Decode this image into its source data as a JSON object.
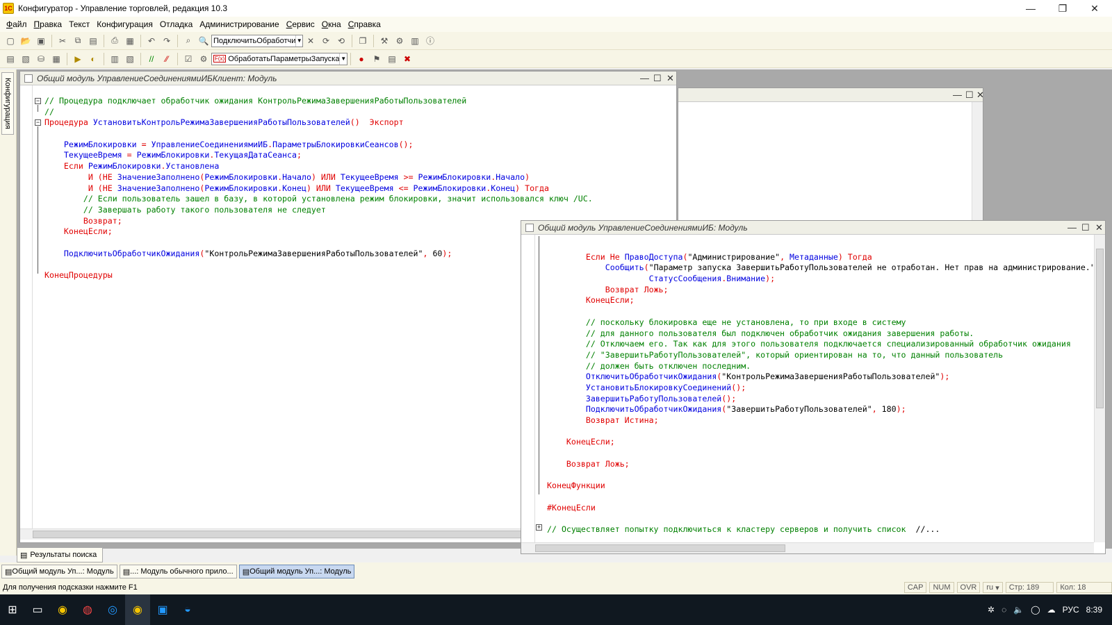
{
  "app": {
    "title": "Конфигуратор - Управление торговлей, редакция 10.3",
    "icon": "1c-app-icon"
  },
  "window_controls": {
    "minimize": "—",
    "restore": "❐",
    "close": "✕"
  },
  "menu": [
    {
      "acc": "Ф",
      "rest": "айл"
    },
    {
      "acc": "П",
      "rest": "равка"
    },
    {
      "acc": "",
      "rest": "Текст"
    },
    {
      "acc": "",
      "rest": "Конфигурация"
    },
    {
      "acc": "",
      "rest": "Отладка"
    },
    {
      "acc": "",
      "rest": "Администрирование"
    },
    {
      "acc": "С",
      "rest": "ервис"
    },
    {
      "acc": "О",
      "rest": "кна"
    },
    {
      "acc": "С",
      "rest": "правка"
    }
  ],
  "toolbar1": {
    "search_combo": "ПодключитьОбработчи"
  },
  "toolbar2": {
    "procedure_combo": "ОбработатьПараметрыЗапуска",
    "procedure_badge": "F(x)"
  },
  "side_tab": "Конфигурация",
  "window_client": {
    "title": "Общий модуль УправлениеСоединениямиИБКлиент: Модуль",
    "lines": [
      [
        [
          "cm",
          "// Процедура подключает обработчик ожидания КонтрольРежимаЗавершенияРаботыПользователей"
        ]
      ],
      [
        [
          "cm",
          "//"
        ]
      ],
      [
        [
          "kw",
          "Процедура "
        ],
        [
          "id",
          "УстановитьКонтрольРежимаЗавершенияРаботыПользователей"
        ],
        [
          "kw",
          "()  Экспорт"
        ]
      ],
      [],
      [
        [
          "st",
          "    "
        ],
        [
          "id",
          "РежимБлокировки"
        ],
        [
          "kw",
          " = "
        ],
        [
          "id",
          "УправлениеСоединениямиИБ"
        ],
        [
          "kw",
          "."
        ],
        [
          "id",
          "ПараметрыБлокировкиСеансов"
        ],
        [
          "kw",
          "();"
        ]
      ],
      [
        [
          "st",
          "    "
        ],
        [
          "id",
          "ТекущееВремя"
        ],
        [
          "kw",
          " = "
        ],
        [
          "id",
          "РежимБлокировки"
        ],
        [
          "kw",
          "."
        ],
        [
          "id",
          "ТекущаяДатаСеанса"
        ],
        [
          "kw",
          ";"
        ]
      ],
      [
        [
          "st",
          "    "
        ],
        [
          "kw",
          "Если "
        ],
        [
          "id",
          "РежимБлокировки"
        ],
        [
          "kw",
          "."
        ],
        [
          "id",
          "Установлена"
        ]
      ],
      [
        [
          "st",
          "         "
        ],
        [
          "kw",
          "И (НЕ "
        ],
        [
          "id",
          "ЗначениеЗаполнено"
        ],
        [
          "kw",
          "("
        ],
        [
          "id",
          "РежимБлокировки"
        ],
        [
          "kw",
          "."
        ],
        [
          "id",
          "Начало"
        ],
        [
          "kw",
          ") ИЛИ "
        ],
        [
          "id",
          "ТекущееВремя"
        ],
        [
          "kw",
          " >= "
        ],
        [
          "id",
          "РежимБлокировки"
        ],
        [
          "kw",
          "."
        ],
        [
          "id",
          "Начало"
        ],
        [
          "kw",
          ")"
        ]
      ],
      [
        [
          "st",
          "         "
        ],
        [
          "kw",
          "И (НЕ "
        ],
        [
          "id",
          "ЗначениеЗаполнено"
        ],
        [
          "kw",
          "("
        ],
        [
          "id",
          "РежимБлокировки"
        ],
        [
          "kw",
          "."
        ],
        [
          "id",
          "Конец"
        ],
        [
          "kw",
          ") ИЛИ "
        ],
        [
          "id",
          "ТекущееВремя"
        ],
        [
          "kw",
          " <= "
        ],
        [
          "id",
          "РежимБлокировки"
        ],
        [
          "kw",
          "."
        ],
        [
          "id",
          "Конец"
        ],
        [
          "kw",
          ") Тогда"
        ]
      ],
      [
        [
          "st",
          "        "
        ],
        [
          "cm",
          "// Если пользователь зашел в базу, в которой установлена режим блокировки, значит использовался ключ /UC."
        ]
      ],
      [
        [
          "st",
          "        "
        ],
        [
          "cm",
          "// Завершать работу такого пользователя не следует"
        ]
      ],
      [
        [
          "st",
          "        "
        ],
        [
          "kw",
          "Возврат;"
        ]
      ],
      [
        [
          "st",
          "    "
        ],
        [
          "kw",
          "КонецЕсли;"
        ]
      ],
      [],
      [
        [
          "st",
          "    "
        ],
        [
          "id",
          "ПодключитьОбработчикОжидания"
        ],
        [
          "kw",
          "("
        ],
        [
          "st",
          "\"КонтрольРежимаЗавершенияРаботыПользователей\""
        ],
        [
          "kw",
          ", "
        ],
        [
          "nm",
          "60"
        ],
        [
          "kw",
          ");"
        ]
      ],
      [],
      [
        [
          "kw",
          "КонецПроцедуры"
        ]
      ]
    ]
  },
  "window_module": {
    "title": "Общий модуль УправлениеСоединениямиИБ: Модуль",
    "lines": [
      [],
      [
        [
          "st",
          "        "
        ],
        [
          "kw",
          "Если Не "
        ],
        [
          "id",
          "ПравоДоступа"
        ],
        [
          "kw",
          "("
        ],
        [
          "st",
          "\"Администрирование\""
        ],
        [
          "kw",
          ", "
        ],
        [
          "id",
          "Метаданные"
        ],
        [
          "kw",
          ") Тогда"
        ]
      ],
      [
        [
          "st",
          "            "
        ],
        [
          "id",
          "Сообщить"
        ],
        [
          "kw",
          "("
        ],
        [
          "st",
          "\"Параметр запуска ЗавершитьРаботуПользователей не отработан. Нет прав на администрирование.\""
        ],
        [
          "kw",
          ","
        ]
      ],
      [
        [
          "st",
          "                     "
        ],
        [
          "id",
          "СтатусСообщения"
        ],
        [
          "kw",
          "."
        ],
        [
          "id",
          "Внимание"
        ],
        [
          "kw",
          ");"
        ]
      ],
      [
        [
          "st",
          "            "
        ],
        [
          "kw",
          "Возврат Ложь;"
        ]
      ],
      [
        [
          "st",
          "        "
        ],
        [
          "kw",
          "КонецЕсли;"
        ]
      ],
      [],
      [
        [
          "st",
          "        "
        ],
        [
          "cm",
          "// поскольку блокировка еще не установлена, то при входе в систему"
        ]
      ],
      [
        [
          "st",
          "        "
        ],
        [
          "cm",
          "// для данного пользователя был подключен обработчик ожидания завершения работы."
        ]
      ],
      [
        [
          "st",
          "        "
        ],
        [
          "cm",
          "// Отключаем его. Так как для этого пользователя подключается специализированный обработчик ожидания"
        ]
      ],
      [
        [
          "st",
          "        "
        ],
        [
          "cm",
          "// \"ЗавершитьРаботуПользователей\", который ориентирован на то, что данный пользователь"
        ]
      ],
      [
        [
          "st",
          "        "
        ],
        [
          "cm",
          "// должен быть отключен последним."
        ]
      ],
      [
        [
          "st",
          "        "
        ],
        [
          "id",
          "ОтключитьОбработчикОжидания"
        ],
        [
          "kw",
          "("
        ],
        [
          "st",
          "\"КонтрольРежимаЗавершенияРаботыПользователей\""
        ],
        [
          "kw",
          ");"
        ]
      ],
      [
        [
          "st",
          "        "
        ],
        [
          "id",
          "УстановитьБлокировкуСоединений"
        ],
        [
          "kw",
          "();"
        ]
      ],
      [
        [
          "st",
          "        "
        ],
        [
          "id",
          "ЗавершитьРаботуПользователей"
        ],
        [
          "kw",
          "();"
        ]
      ],
      [
        [
          "st",
          "        "
        ],
        [
          "id",
          "ПодключитьОбработчикОжидания"
        ],
        [
          "kw",
          "("
        ],
        [
          "st",
          "\"ЗавершитьРаботуПользователей\""
        ],
        [
          "kw",
          ", "
        ],
        [
          "nm",
          "180"
        ],
        [
          "kw",
          ");"
        ]
      ],
      [
        [
          "st",
          "        "
        ],
        [
          "kw",
          "Возврат Истина;"
        ]
      ],
      [],
      [
        [
          "st",
          "    "
        ],
        [
          "kw",
          "КонецЕсли;"
        ]
      ],
      [],
      [
        [
          "st",
          "    "
        ],
        [
          "kw",
          "Возврат Ложь;"
        ]
      ],
      [],
      [
        [
          "kw",
          "КонецФункции"
        ]
      ],
      [],
      [
        [
          "kw",
          "#КонецЕсли"
        ]
      ],
      [],
      [
        [
          "cm",
          "// Осуществляет попытку подключиться к кластеру серверов и получить список  "
        ],
        [
          "st",
          "//..."
        ]
      ]
    ]
  },
  "panels": {
    "search_results": "Результаты поиска"
  },
  "tasks": [
    {
      "label": "Общий модуль Уп...: Модуль",
      "active": false
    },
    {
      "label": "...: Модуль обычного прило...",
      "active": false
    },
    {
      "label": "Общий модуль Уп...: Модуль",
      "active": true
    }
  ],
  "status": {
    "hint": "Для получения подсказки нажмите F1",
    "cap": "CAP",
    "num": "NUM",
    "ovr": "OVR",
    "lang": "ru",
    "line": "Стр: 189",
    "col": "Кол: 18"
  },
  "taskbar": {
    "lang": "РУС",
    "time": "8:39"
  }
}
